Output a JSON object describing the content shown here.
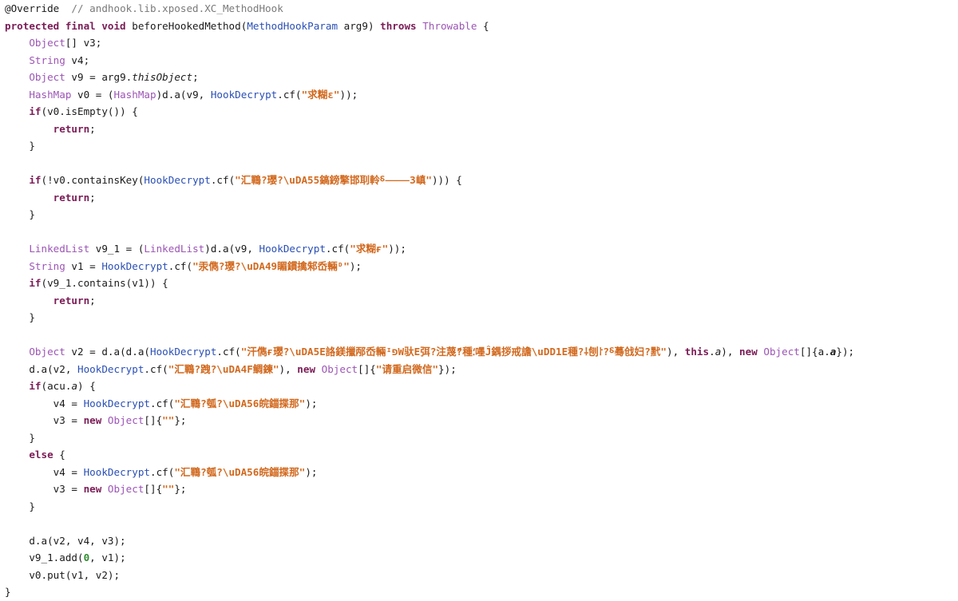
{
  "code": {
    "lines": [
      [
        {
          "t": "@Override  ",
          "c": "pl"
        },
        {
          "t": "// andhook.lib.xposed.XC_MethodHook",
          "c": "cmt"
        }
      ],
      [
        {
          "t": "protected final void",
          "c": "kw"
        },
        {
          "t": " beforeHookedMethod(",
          "c": "pl"
        },
        {
          "t": "MethodHookParam",
          "c": "cls"
        },
        {
          "t": " arg9) ",
          "c": "pl"
        },
        {
          "t": "throws",
          "c": "kw"
        },
        {
          "t": " ",
          "c": "pl"
        },
        {
          "t": "Throwable",
          "c": "type"
        },
        {
          "t": " {",
          "c": "pl"
        }
      ],
      [
        {
          "t": "    ",
          "c": "pl"
        },
        {
          "t": "Object",
          "c": "type"
        },
        {
          "t": "[] v3;",
          "c": "pl"
        }
      ],
      [
        {
          "t": "    ",
          "c": "pl"
        },
        {
          "t": "String",
          "c": "type"
        },
        {
          "t": " v4;",
          "c": "pl"
        }
      ],
      [
        {
          "t": "    ",
          "c": "pl"
        },
        {
          "t": "Object",
          "c": "type"
        },
        {
          "t": " v9 = arg9.",
          "c": "pl"
        },
        {
          "t": "thisObject",
          "c": "fld"
        },
        {
          "t": ";",
          "c": "pl"
        }
      ],
      [
        {
          "t": "    ",
          "c": "pl"
        },
        {
          "t": "HashMap",
          "c": "type"
        },
        {
          "t": " v0 = (",
          "c": "pl"
        },
        {
          "t": "HashMap",
          "c": "type"
        },
        {
          "t": ")d.a(v9, ",
          "c": "pl"
        },
        {
          "t": "HookDecrypt",
          "c": "cls"
        },
        {
          "t": ".cf(",
          "c": "pl"
        },
        {
          "t": "\"求糊ε\"",
          "c": "str"
        },
        {
          "t": "));",
          "c": "pl"
        }
      ],
      [
        {
          "t": "    ",
          "c": "pl"
        },
        {
          "t": "if",
          "c": "kw"
        },
        {
          "t": "(v0.isEmpty()) {",
          "c": "pl"
        }
      ],
      [
        {
          "t": "        ",
          "c": "pl"
        },
        {
          "t": "return",
          "c": "kw"
        },
        {
          "t": ";",
          "c": "pl"
        }
      ],
      [
        {
          "t": "    }",
          "c": "pl"
        }
      ],
      [
        {
          "t": "",
          "c": "pl"
        }
      ],
      [
        {
          "t": "    ",
          "c": "pl"
        },
        {
          "t": "if",
          "c": "kw"
        },
        {
          "t": "(!v0.containsKey(",
          "c": "pl"
        },
        {
          "t": "HookDecrypt",
          "c": "cls"
        },
        {
          "t": ".cf(",
          "c": "pl"
        },
        {
          "t": "\"汇鶤?瓔?\\uDA55鎬鎊擎邯刵軨⸹⸻3嵮\"",
          "c": "str"
        },
        {
          "t": "))) {",
          "c": "pl"
        }
      ],
      [
        {
          "t": "        ",
          "c": "pl"
        },
        {
          "t": "return",
          "c": "kw"
        },
        {
          "t": ";",
          "c": "pl"
        }
      ],
      [
        {
          "t": "    }",
          "c": "pl"
        }
      ],
      [
        {
          "t": "",
          "c": "pl"
        }
      ],
      [
        {
          "t": "    ",
          "c": "pl"
        },
        {
          "t": "LinkedList",
          "c": "type"
        },
        {
          "t": " v9_1 = (",
          "c": "pl"
        },
        {
          "t": "LinkedList",
          "c": "type"
        },
        {
          "t": ")d.a(v9, ",
          "c": "pl"
        },
        {
          "t": "HookDecrypt",
          "c": "cls"
        },
        {
          "t": ".cf(",
          "c": "pl"
        },
        {
          "t": "\"求糊ғ\"",
          "c": "str"
        },
        {
          "t": "));",
          "c": "pl"
        }
      ],
      [
        {
          "t": "    ",
          "c": "pl"
        },
        {
          "t": "String",
          "c": "type"
        },
        {
          "t": " v1 = ",
          "c": "pl"
        },
        {
          "t": "HookDecrypt",
          "c": "cls"
        },
        {
          "t": ".cf(",
          "c": "pl"
        },
        {
          "t": "\"汞儁?瓔?\\uDA49睸鏆擒邾岙輛ᴰ\"",
          "c": "str"
        },
        {
          "t": ");",
          "c": "pl"
        }
      ],
      [
        {
          "t": "    ",
          "c": "pl"
        },
        {
          "t": "if",
          "c": "kw"
        },
        {
          "t": "(v9_1.contains(v1)) {",
          "c": "pl"
        }
      ],
      [
        {
          "t": "        ",
          "c": "pl"
        },
        {
          "t": "return",
          "c": "kw"
        },
        {
          "t": ";",
          "c": "pl"
        }
      ],
      [
        {
          "t": "    }",
          "c": "pl"
        }
      ],
      [
        {
          "t": "",
          "c": "pl"
        }
      ],
      [
        {
          "t": "    ",
          "c": "pl"
        },
        {
          "t": "Object",
          "c": "type"
        },
        {
          "t": " v2 = d.a(d.a(",
          "c": "pl"
        },
        {
          "t": "HookDecrypt",
          "c": "cls"
        },
        {
          "t": ".cf(",
          "c": "pl"
        },
        {
          "t": "\"汗儁ғ瓔?\\uDA5E詻鎂擸邴岙輛ᴵפW驮E弭?注蔑́?種⸵嚜Ĵ鍝拶戒譫\\uDD1E種?⸸刨⸷?⸹蓦戗妇?黓\"",
          "c": "str"
        },
        {
          "t": "), ",
          "c": "pl"
        },
        {
          "t": "this",
          "c": "kw"
        },
        {
          "t": ".",
          "c": "pl"
        },
        {
          "t": "a",
          "c": "fld"
        },
        {
          "t": "), ",
          "c": "pl"
        },
        {
          "t": "new",
          "c": "kw"
        },
        {
          "t": " ",
          "c": "pl"
        },
        {
          "t": "Object",
          "c": "type"
        },
        {
          "t": "[]{a.",
          "c": "pl"
        },
        {
          "t": "a",
          "c": "fldb"
        },
        {
          "t": "});",
          "c": "pl"
        }
      ],
      [
        {
          "t": "    d.a(v2, ",
          "c": "pl"
        },
        {
          "t": "HookDecrypt",
          "c": "cls"
        },
        {
          "t": ".cf(",
          "c": "pl"
        },
        {
          "t": "\"汇鶤?跩?\\uDA4F鲷鍊\"",
          "c": "str"
        },
        {
          "t": "), ",
          "c": "pl"
        },
        {
          "t": "new",
          "c": "kw"
        },
        {
          "t": " ",
          "c": "pl"
        },
        {
          "t": "Object",
          "c": "type"
        },
        {
          "t": "[]{",
          "c": "pl"
        },
        {
          "t": "\"请重启微信\"",
          "c": "str"
        },
        {
          "t": "});",
          "c": "pl"
        }
      ],
      [
        {
          "t": "    ",
          "c": "pl"
        },
        {
          "t": "if",
          "c": "kw"
        },
        {
          "t": "(acu.",
          "c": "pl"
        },
        {
          "t": "a",
          "c": "fld"
        },
        {
          "t": ") {",
          "c": "pl"
        }
      ],
      [
        {
          "t": "        v4 = ",
          "c": "pl"
        },
        {
          "t": "HookDecrypt",
          "c": "cls"
        },
        {
          "t": ".cf(",
          "c": "pl"
        },
        {
          "t": "\"汇鶤?瓠?\\uDA56皖鍿揲那\"",
          "c": "str"
        },
        {
          "t": ");",
          "c": "pl"
        }
      ],
      [
        {
          "t": "        v3 = ",
          "c": "pl"
        },
        {
          "t": "new",
          "c": "kw"
        },
        {
          "t": " ",
          "c": "pl"
        },
        {
          "t": "Object",
          "c": "type"
        },
        {
          "t": "[]{",
          "c": "pl"
        },
        {
          "t": "\"\"",
          "c": "str"
        },
        {
          "t": "};",
          "c": "pl"
        }
      ],
      [
        {
          "t": "    }",
          "c": "pl"
        }
      ],
      [
        {
          "t": "    ",
          "c": "pl"
        },
        {
          "t": "else",
          "c": "kw"
        },
        {
          "t": " {",
          "c": "pl"
        }
      ],
      [
        {
          "t": "        v4 = ",
          "c": "pl"
        },
        {
          "t": "HookDecrypt",
          "c": "cls"
        },
        {
          "t": ".cf(",
          "c": "pl"
        },
        {
          "t": "\"汇鶤?瓠?\\uDA56皖鍿揲那\"",
          "c": "str"
        },
        {
          "t": ");",
          "c": "pl"
        }
      ],
      [
        {
          "t": "        v3 = ",
          "c": "pl"
        },
        {
          "t": "new",
          "c": "kw"
        },
        {
          "t": " ",
          "c": "pl"
        },
        {
          "t": "Object",
          "c": "type"
        },
        {
          "t": "[]{",
          "c": "pl"
        },
        {
          "t": "\"\"",
          "c": "str"
        },
        {
          "t": "};",
          "c": "pl"
        }
      ],
      [
        {
          "t": "    }",
          "c": "pl"
        }
      ],
      [
        {
          "t": "",
          "c": "pl"
        }
      ],
      [
        {
          "t": "    d.a(v2, v4, v3);",
          "c": "pl"
        }
      ],
      [
        {
          "t": "    v9_1.add(",
          "c": "pl"
        },
        {
          "t": "0",
          "c": "num"
        },
        {
          "t": ", v1);",
          "c": "pl"
        }
      ],
      [
        {
          "t": "    v0.put(v1, v2);",
          "c": "pl"
        }
      ],
      [
        {
          "t": "}",
          "c": "pl"
        }
      ]
    ]
  }
}
